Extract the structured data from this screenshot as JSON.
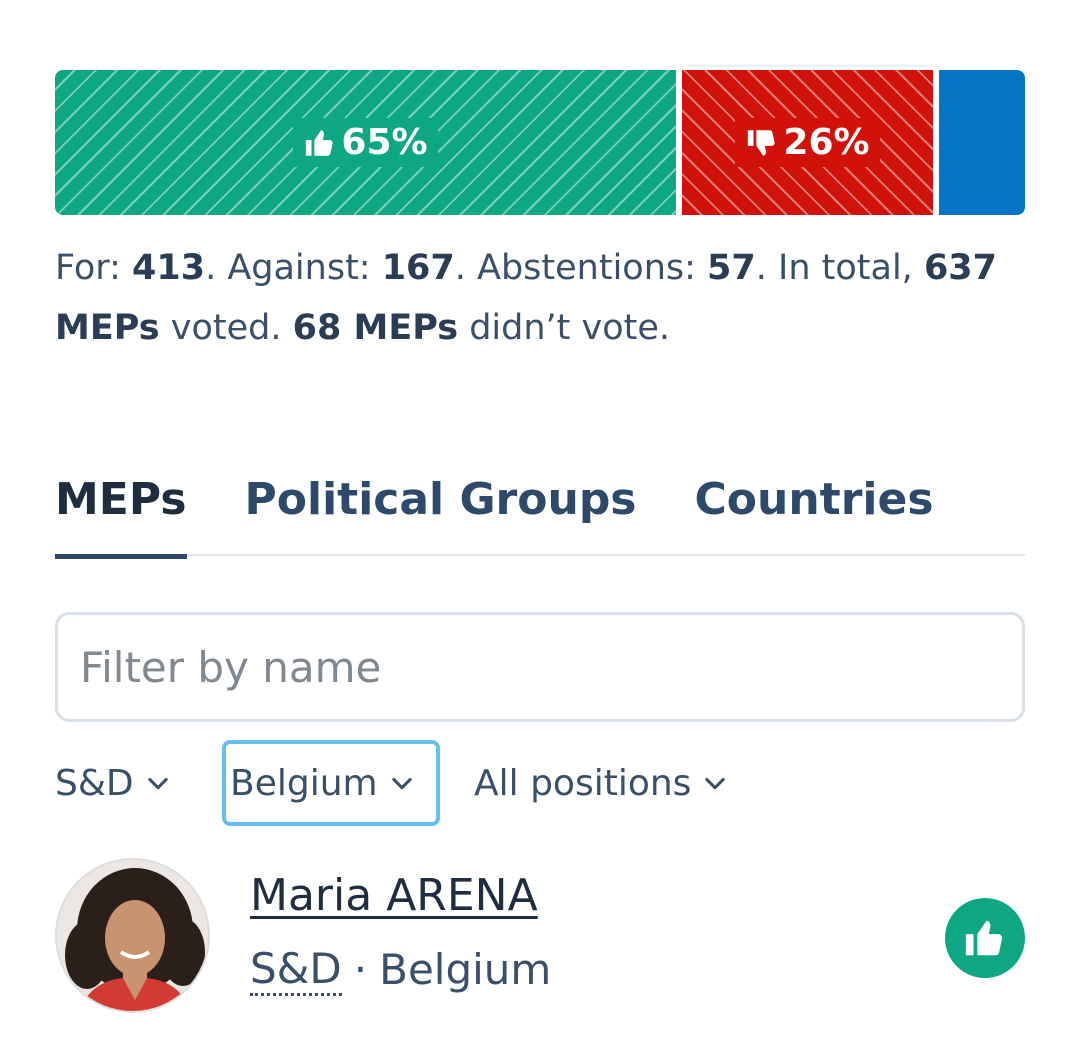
{
  "result": {
    "for_fraction": 0.65,
    "against_fraction": 0.26,
    "for_percent": "65%",
    "against_percent": "26%",
    "colors": {
      "for": "#0ea784",
      "against": "#d0120a",
      "abstention": "#0474c4"
    },
    "icons": {
      "for": "thumbs-up-icon",
      "against": "thumbs-down-icon"
    }
  },
  "summary": {
    "for_label": "For: ",
    "for_count": "413",
    "against_label": ". Against: ",
    "against_count": "167",
    "abst_label": ". Abstentions: ",
    "abst_count": "57",
    "total_label": ". In total, ",
    "voted_count": "637 MEPs",
    "voted_label": " voted. ",
    "not_voted_count": "68 MEPs",
    "not_voted_label": " didn’t vote."
  },
  "tabs": [
    {
      "label": "MEPs",
      "active": true
    },
    {
      "label": "Political Groups",
      "active": false
    },
    {
      "label": "Countries",
      "active": false
    }
  ],
  "filter": {
    "placeholder": "Filter by name",
    "value": ""
  },
  "dropdowns": {
    "group": "S&D",
    "country": "Belgium",
    "position": "All positions"
  },
  "meps": [
    {
      "name": "Maria ARENA",
      "group": "S&D",
      "separator": "·",
      "country": "Belgium",
      "position_icon": "thumbs-up-icon"
    }
  ]
}
